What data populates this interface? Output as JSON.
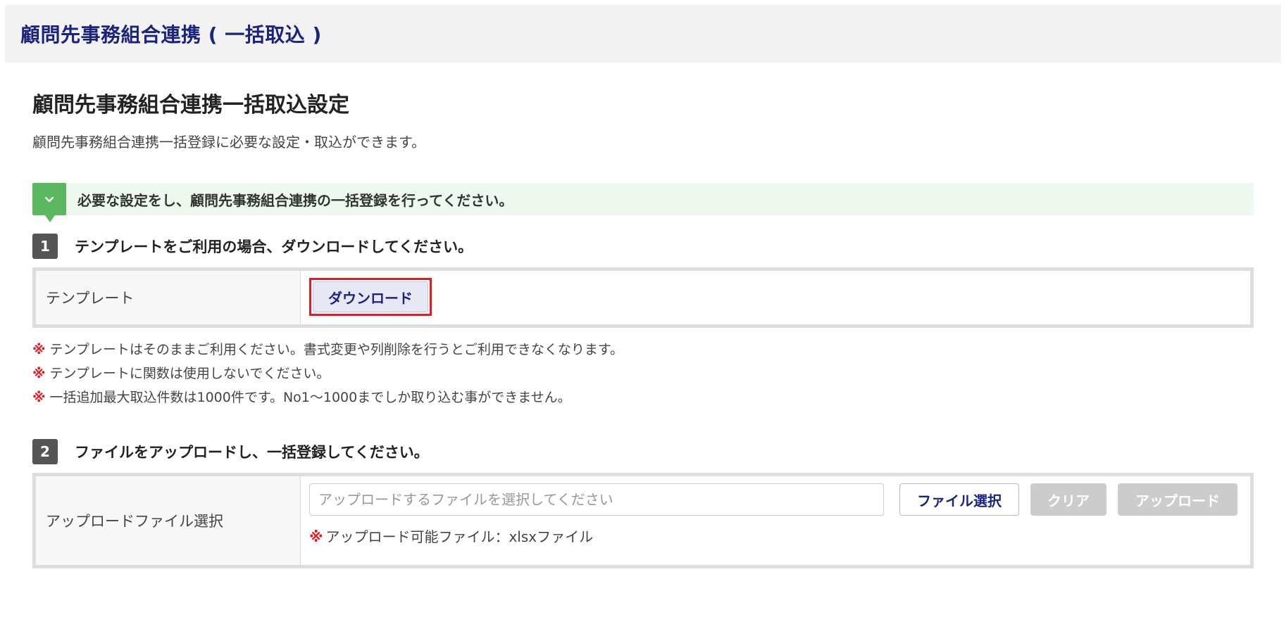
{
  "header": {
    "title": "顧問先事務組合連携 ( 一括取込 )"
  },
  "main": {
    "title": "顧問先事務組合連携一括取込設定",
    "description": "顧問先事務組合連携一括登録に必要な設定・取込ができます。",
    "guide": {
      "icon": "chevron-down-icon",
      "text": "必要な設定をし、顧問先事務組合連携の一括登録を行ってください。"
    }
  },
  "step1": {
    "number": "1",
    "text": "テンプレートをご利用の場合、ダウンロードしてください。",
    "row_label": "テンプレート",
    "download_label": "ダウンロード",
    "notes": [
      "テンプレートはそのままご利用ください。書式変更や列削除を行うとご利用できなくなります。",
      "テンプレートに関数は使用しないでください。",
      "一括追加最大取込件数は1000件です。No1～1000までしか取り込む事ができません。"
    ],
    "note_mark": "※"
  },
  "step2": {
    "number": "2",
    "text": "ファイルをアップロードし、一括登録してください。",
    "row_label": "アップロードファイル選択",
    "file_value": "",
    "file_placeholder": "アップロードするファイルを選択してください",
    "select_label": "ファイル選択",
    "clear_label": "クリア",
    "upload_label": "アップロード",
    "note_mark": "※",
    "note": "アップロード可能ファイル：xlsxファイル"
  },
  "colors": {
    "accent": "#1a237e",
    "guide_green": "#5cb860",
    "highlight_red": "#e31b23",
    "disabled_gray": "#cccccc"
  }
}
